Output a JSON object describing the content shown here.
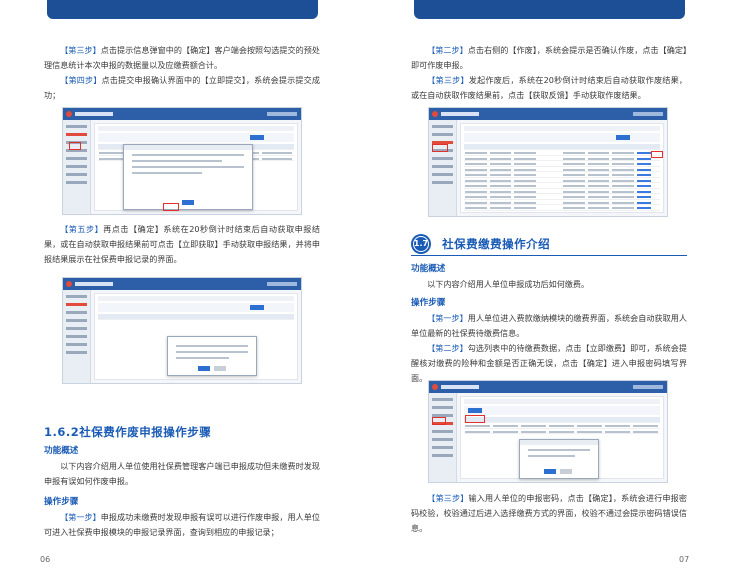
{
  "left": {
    "p1_step": "【第三步】",
    "p1_text": "点击提示信息弹窗中的【确定】客户端会按照勾选提交的预处理信息统计本次申报的数据量以及应缴费额合计。",
    "p2_step": "【第四步】",
    "p2_text": "点击提交申报确认界面中的【立即提交】，系统会提示提交成功；",
    "p3_step": "【第五步】",
    "p3_text": "再点击【确定】系统在20秒倒计时结束后自动获取申报结果，或在自动获取申报结果前可点击【立即获取】手动获取申报结果，并将申报结果展示在社保费申报记录的界面。",
    "section_title": "1.6.2社保费作废申报操作步骤",
    "func_head": "功能概述",
    "func_text": "以下内容介绍用人单位使用社保费管理客户端已申报成功但未缴费时发现申报有误如何作废申报。",
    "ops_head": "操作步骤",
    "p4_step": "【第一步】",
    "p4_text": "申报成功未缴费时发现申报有误可以进行作废申报，用人单位可进入社保费申报模块的申报记录界面，查询到相应的申报记录；",
    "page_number": "06"
  },
  "right": {
    "p1_step": "【第二步】",
    "p1_text": "点击右侧的【作废】，系统会提示是否确认作废，点击【确定】即可作废申报。",
    "p2_step": "【第三步】",
    "p2_text": "发起作废后，系统在20秒倒计时结束后自动获取作废结果，或在自动获取作废结果前，点击【获取反馈】手动获取作废结果。",
    "section_number": "1.7",
    "section_title": "社保费缴费操作介绍",
    "func_head": "功能概述",
    "func_text": "以下内容介绍用人单位申报成功后如何缴费。",
    "ops_head": "操作步骤",
    "p3_step": "【第一步】",
    "p3_text": "用人单位进入费款缴纳模块的缴费界面，系统会自动获取用人单位最新的社保费待缴费信息。",
    "p4_step": "【第二步】",
    "p4_text": "勾选列表中的待缴费数据，点击【立即缴费】即可，系统会提醒核对缴费的险种和金额是否正确无误，点击【确定】进入申报密码填写界面。",
    "p5_step": "【第三步】",
    "p5_text": "输入用人单位的申报密码，点击【确定】，系统会进行申报密码校验，校验通过后进入选择缴费方式的界面，校验不通过会提示密码错误信息。",
    "page_number": "07"
  },
  "colors": {
    "accent": "#1a5bb5",
    "header_tab": "#1d4f96",
    "highlight": "#e0322b"
  }
}
